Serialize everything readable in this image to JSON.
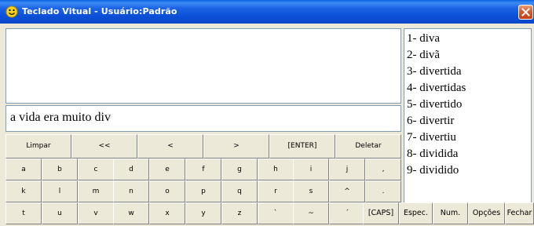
{
  "window": {
    "title": "Teclado Vitual - Usuário:Padrão",
    "title_icon": "smiley-icon",
    "accent": "#0a4fd6"
  },
  "editor": {
    "text": "a vida era muito div"
  },
  "suggestions": [
    "1- diva",
    "2- divã",
    "3- divertida",
    "4- divertidas",
    "5- divertido",
    "6- divertir",
    "7- divertiu",
    "8- dividida",
    "9- dividido"
  ],
  "controls": [
    "Limpar",
    "<<",
    "<",
    ">",
    "[ENTER]",
    "Deletar"
  ],
  "keys_row1": [
    "a",
    "b",
    "c",
    "d",
    "e",
    "f",
    "g",
    "h",
    "i",
    "j",
    ","
  ],
  "keys_row2": [
    "k",
    "l",
    "m",
    "n",
    "o",
    "p",
    "q",
    "r",
    "s",
    "^",
    "."
  ],
  "keys_row3": [
    "t",
    "u",
    "v",
    "w",
    "x",
    "y",
    "z",
    "`",
    "~",
    "´"
  ],
  "function_keys": [
    "[CAPS]",
    "Espec.",
    "Num.",
    "Opções",
    "Fechar"
  ]
}
